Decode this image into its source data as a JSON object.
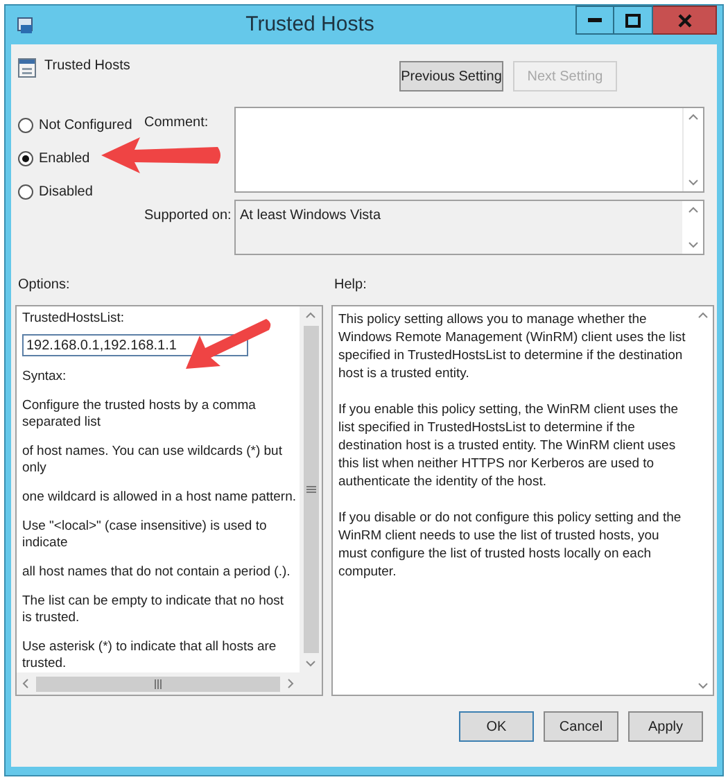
{
  "window": {
    "title": "Trusted Hosts"
  },
  "setting_name": "Trusted Hosts",
  "nav_buttons": [
    {
      "label": "Previous Setting",
      "disabled": false
    },
    {
      "label": "Next Setting",
      "disabled": true
    }
  ],
  "state_options": [
    {
      "label": "Not Configured",
      "selected": false
    },
    {
      "label": "Enabled",
      "selected": true
    },
    {
      "label": "Disabled",
      "selected": false
    }
  ],
  "comment": {
    "label": "Comment:"
  },
  "supported_on": {
    "label": "Supported on:",
    "value": "At least Windows Vista"
  },
  "options": {
    "label": "Options:",
    "field_label": "TrustedHostsList:",
    "value": "192.168.0.1,192.168.1.1",
    "paragraphs": [
      "Syntax:",
      "Configure the trusted hosts by a comma separated list",
      "of host names. You can use wildcards (*) but only",
      "one wildcard is allowed in a host name pattern.",
      "Use \"<local>\" (case insensitive) is used to indicate",
      "all host names that do not contain a period (.).",
      "The list can be empty to indicate that no host is trusted.",
      "Use asterisk (*)  to indicate that all hosts are trusted."
    ]
  },
  "help": {
    "label": "Help:",
    "paragraphs": [
      "This policy setting allows you to manage whether the Windows Remote Management (WinRM) client uses the list specified in TrustedHostsList to determine if the destination host is a trusted entity.",
      "If you enable this policy setting, the WinRM client uses the list specified in TrustedHostsList to determine if the destination host is a trusted entity. The WinRM client uses this list when neither HTTPS nor Kerberos are used to authenticate the identity of the host.",
      "If you disable or do not configure this policy setting and the WinRM client needs to use the list of trusted hosts, you must configure the list of trusted hosts locally on each computer."
    ]
  },
  "buttons": [
    {
      "label": "OK",
      "default": true
    },
    {
      "label": "Cancel",
      "default": false
    },
    {
      "label": "Apply",
      "default": false
    }
  ]
}
